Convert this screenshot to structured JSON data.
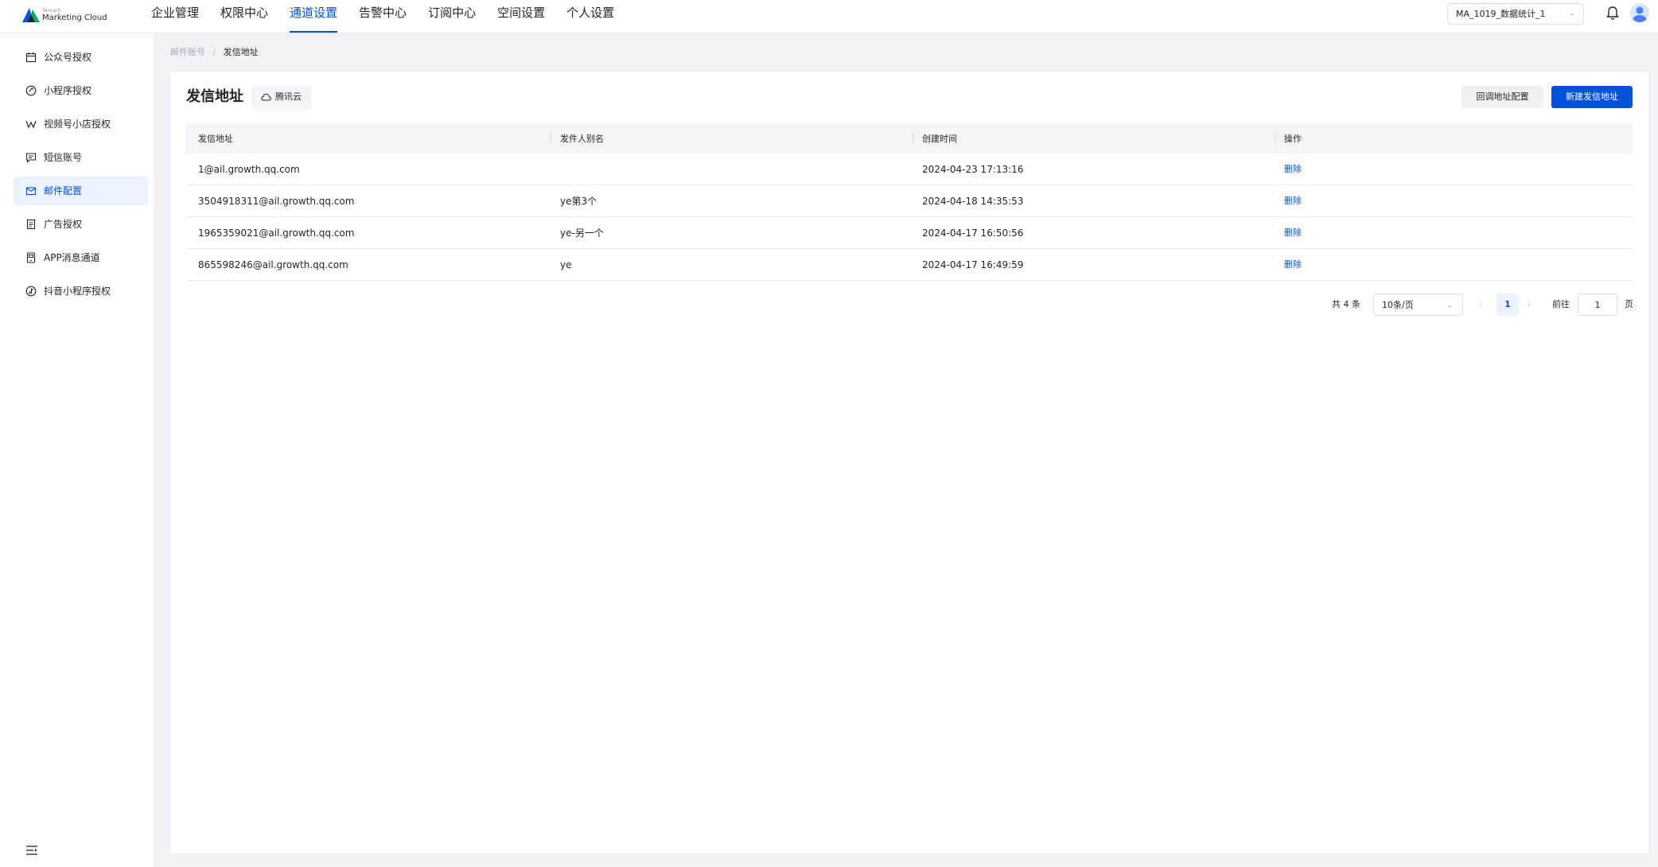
{
  "app": {
    "logo_small": "Tencent",
    "logo_text": "Marketing Cloud"
  },
  "nav": {
    "items": [
      {
        "label": "企业管理"
      },
      {
        "label": "权限中心"
      },
      {
        "label": "通道设置",
        "active": true
      },
      {
        "label": "告警中心"
      },
      {
        "label": "订阅中心"
      },
      {
        "label": "空间设置"
      },
      {
        "label": "个人设置"
      }
    ]
  },
  "header": {
    "space_select_value": "MA_1019_数据统计_1",
    "bell_icon": "bell-icon",
    "avatar_icon": "user-avatar-icon"
  },
  "sidebar": {
    "items": [
      {
        "label": "公众号授权",
        "icon": "calendar-icon"
      },
      {
        "label": "小程序授权",
        "icon": "miniprogram-icon"
      },
      {
        "label": "视频号小店授权",
        "icon": "channels-icon"
      },
      {
        "label": "短信账号",
        "icon": "sms-icon"
      },
      {
        "label": "邮件配置",
        "icon": "mail-icon",
        "active": true
      },
      {
        "label": "广告授权",
        "icon": "ad-icon"
      },
      {
        "label": "APP消息通道",
        "icon": "app-message-icon"
      },
      {
        "label": "抖音小程序授权",
        "icon": "douyin-icon"
      }
    ],
    "collapse_icon": "collapse-menu-icon"
  },
  "breadcrumb": {
    "parent": "邮件账号",
    "separator": "/",
    "current": "发信地址"
  },
  "page": {
    "title": "发信地址",
    "vendor_tag": "腾讯云",
    "btn_callback": "回调地址配置",
    "btn_new": "新建发信地址"
  },
  "table": {
    "columns": [
      "发信地址",
      "发件人别名",
      "创建时间",
      "操作"
    ],
    "rows": [
      {
        "address": "1@ail.growth.qq.com",
        "alias": "",
        "created": "2024-04-23 17:13:16",
        "action": "删除"
      },
      {
        "address": "3504918311@ail.growth.qq.com",
        "alias": "ye第3个",
        "created": "2024-04-18 14:35:53",
        "action": "删除"
      },
      {
        "address": "1965359021@ail.growth.qq.com",
        "alias": "ye-另一个",
        "created": "2024-04-17 16:50:56",
        "action": "删除"
      },
      {
        "address": "865598246@ail.growth.qq.com",
        "alias": "ye",
        "created": "2024-04-17 16:49:59",
        "action": "删除"
      }
    ]
  },
  "pagination": {
    "total": "共 4 条",
    "page_size": "10条/页",
    "current_page": "1",
    "goto_label": "前往",
    "goto_value": "1",
    "page_unit": "页"
  },
  "colors": {
    "primary": "#0052d9",
    "active_bg": "#ecf2fe",
    "page_bg": "#f0f2f7"
  }
}
